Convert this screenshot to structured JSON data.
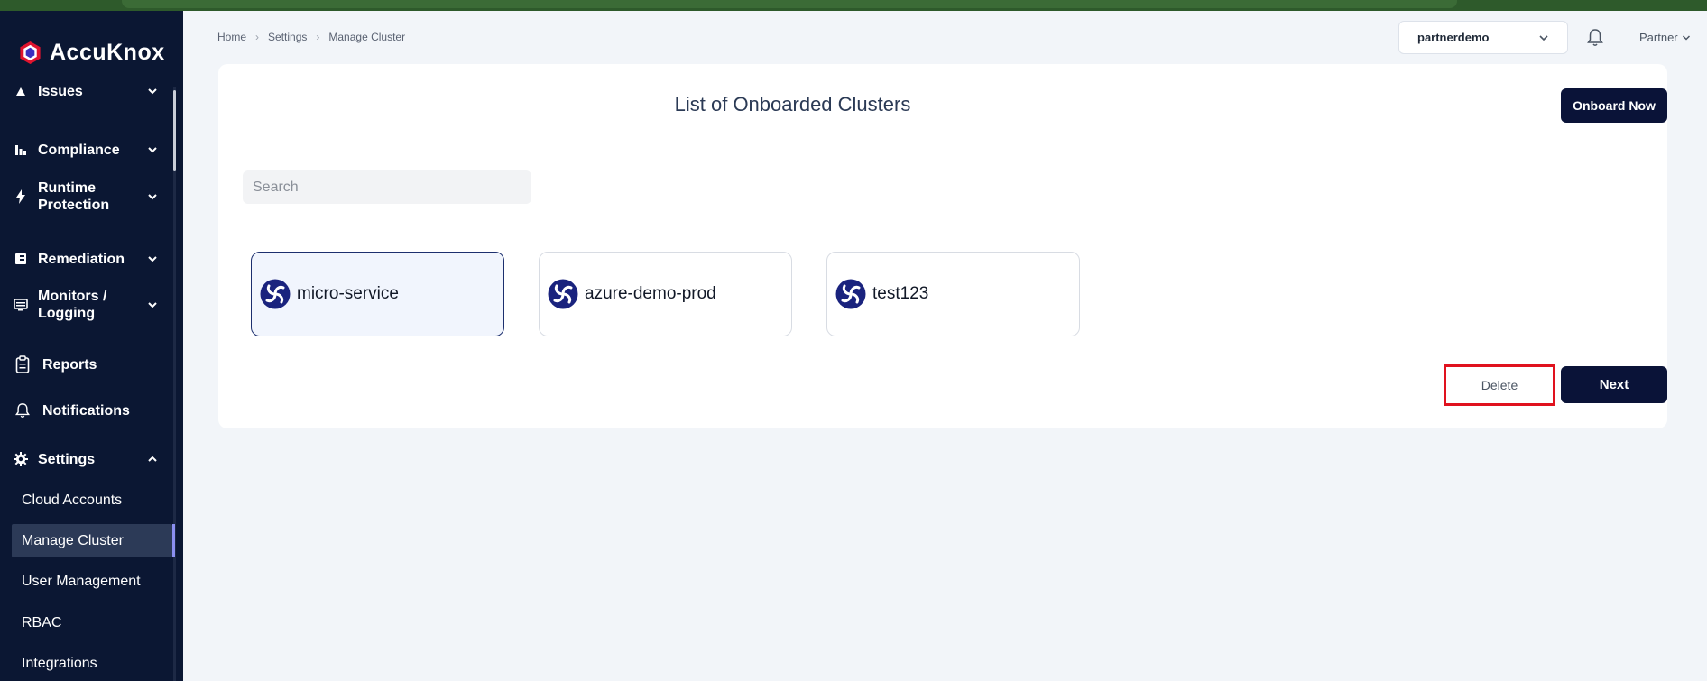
{
  "brand": {
    "name": "AccuKnox"
  },
  "sidebar": {
    "items": [
      {
        "label": "Issues",
        "icon": "issues-icon"
      },
      {
        "label": "Compliance",
        "icon": "bar-chart-icon"
      },
      {
        "label": "Runtime Protection",
        "icon": "lightning-icon"
      },
      {
        "label": "Remediation",
        "icon": "remediation-icon"
      },
      {
        "label": "Monitors / Logging",
        "icon": "monitor-icon"
      },
      {
        "label": "Reports",
        "icon": "clipboard-icon"
      },
      {
        "label": "Notifications",
        "icon": "bell-icon"
      },
      {
        "label": "Settings",
        "icon": "gear-icon"
      }
    ],
    "settings_sub": [
      {
        "label": "Cloud Accounts"
      },
      {
        "label": "Manage Cluster",
        "active": true
      },
      {
        "label": "User Management"
      },
      {
        "label": "RBAC"
      },
      {
        "label": "Integrations"
      }
    ]
  },
  "breadcrumb": [
    "Home",
    "Settings",
    "Manage Cluster"
  ],
  "header": {
    "org_selected": "partnerdemo",
    "user_label": "Partner"
  },
  "main": {
    "title": "List of Onboarded Clusters",
    "onboard_label": "Onboard Now",
    "search_placeholder": "Search",
    "clusters": [
      {
        "name": "micro-service",
        "selected": true
      },
      {
        "name": "azure-demo-prod",
        "selected": false
      },
      {
        "name": "test123",
        "selected": false
      }
    ],
    "delete_label": "Delete",
    "next_label": "Next"
  },
  "colors": {
    "sidebar_bg": "#0b1733",
    "primary_button": "#0a1338",
    "highlight_border": "#e0121e",
    "active_accent": "#8b8ff0"
  }
}
